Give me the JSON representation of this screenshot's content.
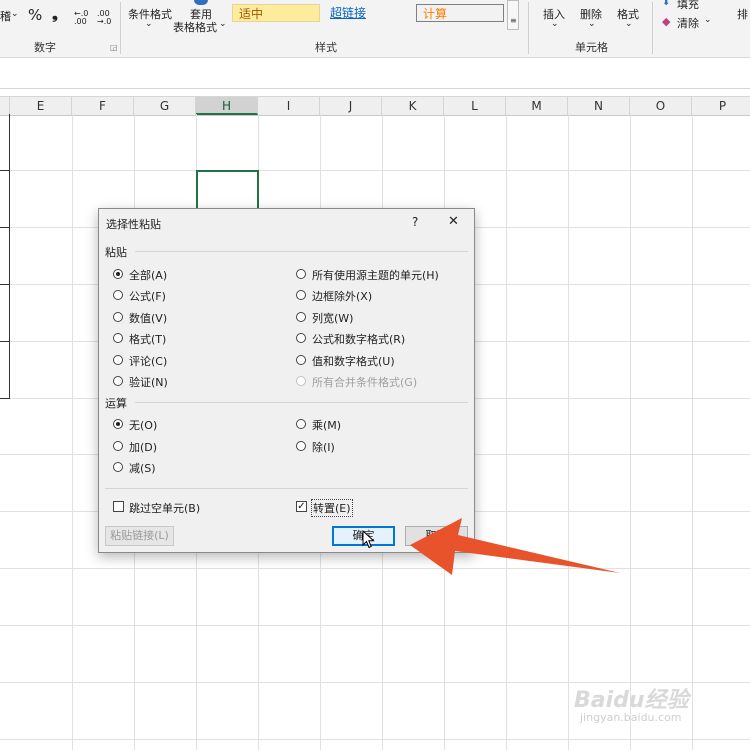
{
  "ribbon": {
    "number_group_label": "数字",
    "styles_group_label": "样式",
    "cells_group_label": "单元格",
    "cut_char": "稽",
    "percent_symbol": "%",
    "comma_symbol": "❟",
    "increase_decimal": "←.0 .00",
    "decrease_decimal": ".00 →.0",
    "conditional_format": "条件格式",
    "table_format_line1": "套用",
    "table_format_line2": "表格格式",
    "style_neutral": "适中",
    "style_hyperlink": "超链接",
    "style_calculation": "计算",
    "insert": "插入",
    "delete": "删除",
    "format": "格式",
    "fill": "填充",
    "clear": "清除",
    "right_cut_char": "排"
  },
  "columns": [
    "E",
    "F",
    "G",
    "H",
    "I",
    "J",
    "K",
    "L",
    "M",
    "N",
    "O",
    "P"
  ],
  "selected_column": "H",
  "dialog": {
    "title": "选择性粘贴",
    "help": "?",
    "close": "✕",
    "paste_section": "粘贴",
    "paste_left": [
      "全部(A)",
      "公式(F)",
      "数值(V)",
      "格式(T)",
      "评论(C)",
      "验证(N)"
    ],
    "paste_right": [
      "所有使用源主题的单元(H)",
      "边框除外(X)",
      "列宽(W)",
      "公式和数字格式(R)",
      "值和数字格式(U)",
      "所有合并条件格式(G)"
    ],
    "operation_section": "运算",
    "op_left": [
      "无(O)",
      "加(D)",
      "减(S)"
    ],
    "op_right": [
      "乘(M)",
      "除(I)"
    ],
    "skip_blanks": "跳过空单元(B)",
    "transpose": "转置(E)",
    "transpose_checked": true,
    "paste_link": "粘贴链接(L)",
    "ok": "确定",
    "cancel": "取消"
  },
  "arrow_color": "#e8532b",
  "watermark": {
    "logo": "Baidu经验",
    "url": "jingyan.baidu.com"
  }
}
